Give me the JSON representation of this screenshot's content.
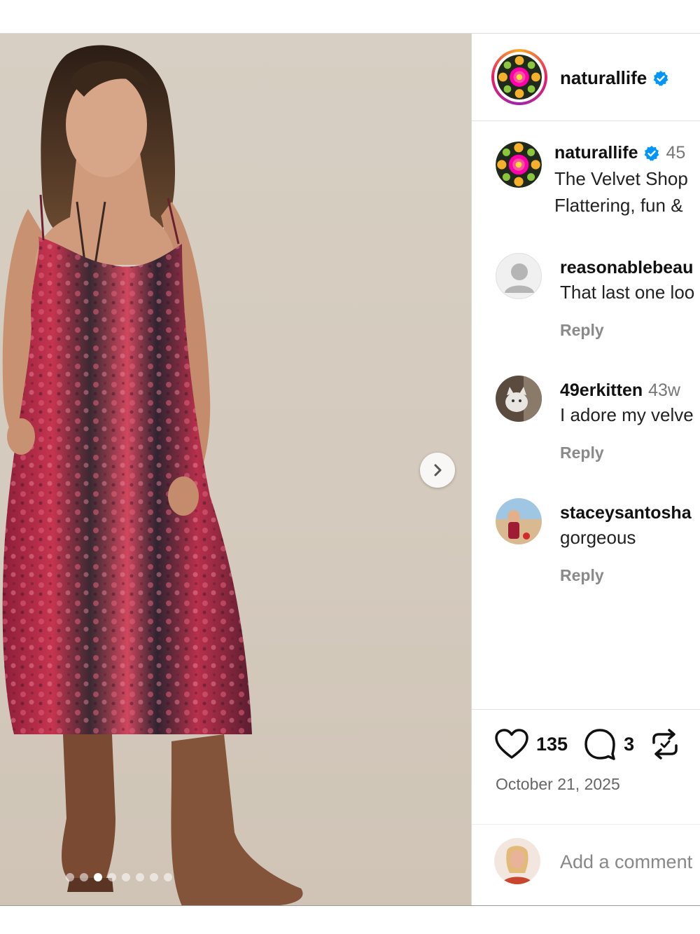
{
  "post": {
    "account": {
      "username": "naturallife",
      "verified_icon": "verified-badge-icon"
    },
    "carousel": {
      "slide_count": 8,
      "active_index": 2,
      "next_icon": "chevron-right-icon"
    },
    "caption": {
      "username": "naturallife",
      "time": "45",
      "line1": "The Velvet Shop",
      "line2": "Flattering, fun &"
    },
    "comments": [
      {
        "username": "reasonablebeau",
        "time": "",
        "text": "That last one loo",
        "reply_label": "Reply",
        "avatar": "default-avatar-icon"
      },
      {
        "username": "49erkitten",
        "time": "43w",
        "text": "I adore my velve",
        "reply_label": "Reply",
        "avatar": "cat-avatar"
      },
      {
        "username": "staceysantosha",
        "time": "",
        "text": "gorgeous",
        "reply_label": "Reply",
        "avatar": "beach-avatar"
      }
    ],
    "actions": {
      "like_count": "135",
      "comment_count": "3",
      "like_icon": "heart-icon",
      "comment_icon": "comment-bubble-icon",
      "repost_icon": "repost-icon"
    },
    "date": "October 21, 2025",
    "add_comment": {
      "placeholder": "Add a comment"
    }
  },
  "colors": {
    "verified": "#0095f6",
    "dress": "#b0283f",
    "background": "#d6cdc1",
    "divider": "#dbdbdb"
  }
}
